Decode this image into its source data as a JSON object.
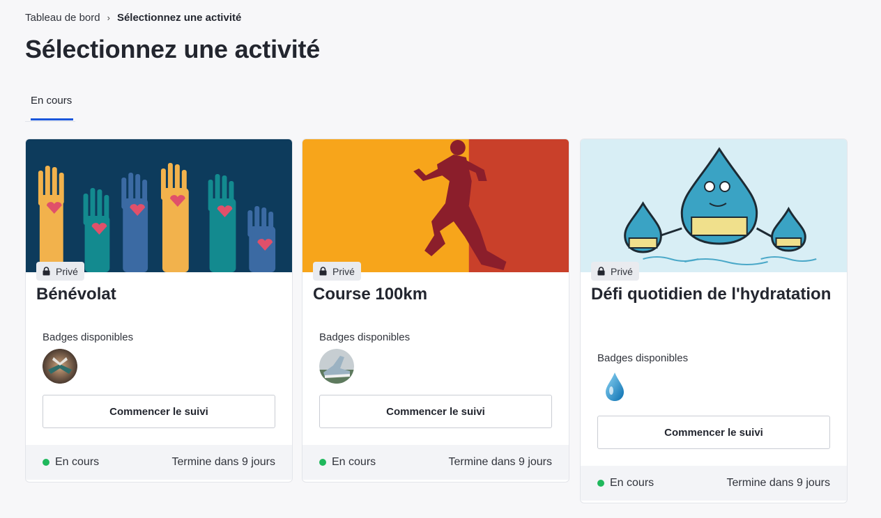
{
  "breadcrumb": {
    "home": "Tableau de bord",
    "current": "Sélectionnez une activité"
  },
  "page_title": "Sélectionnez une activité",
  "tabs": [
    {
      "label": "En cours",
      "active": true
    }
  ],
  "colors": {
    "accent": "#1a56db",
    "status_green": "#1fb85c"
  },
  "cards": [
    {
      "privacy": "Privé",
      "title": "Bénévolat",
      "badges_label": "Badges disponibles",
      "start_button": "Commencer le suivi",
      "status": "En cours",
      "ends": "Termine dans 9 jours",
      "icon": "raised-hands-hearts"
    },
    {
      "privacy": "Privé",
      "title": "Course 100km",
      "badges_label": "Badges disponibles",
      "start_button": "Commencer le suivi",
      "status": "En cours",
      "ends": "Termine dans 9 jours",
      "icon": "runner-silhouette"
    },
    {
      "privacy": "Privé",
      "title": "Défi quotidien de l'hydratation",
      "badges_label": "Badges disponibles",
      "start_button": "Commencer le suivi",
      "status": "En cours",
      "ends": "Termine dans 9 jours",
      "icon": "water-drops"
    }
  ]
}
